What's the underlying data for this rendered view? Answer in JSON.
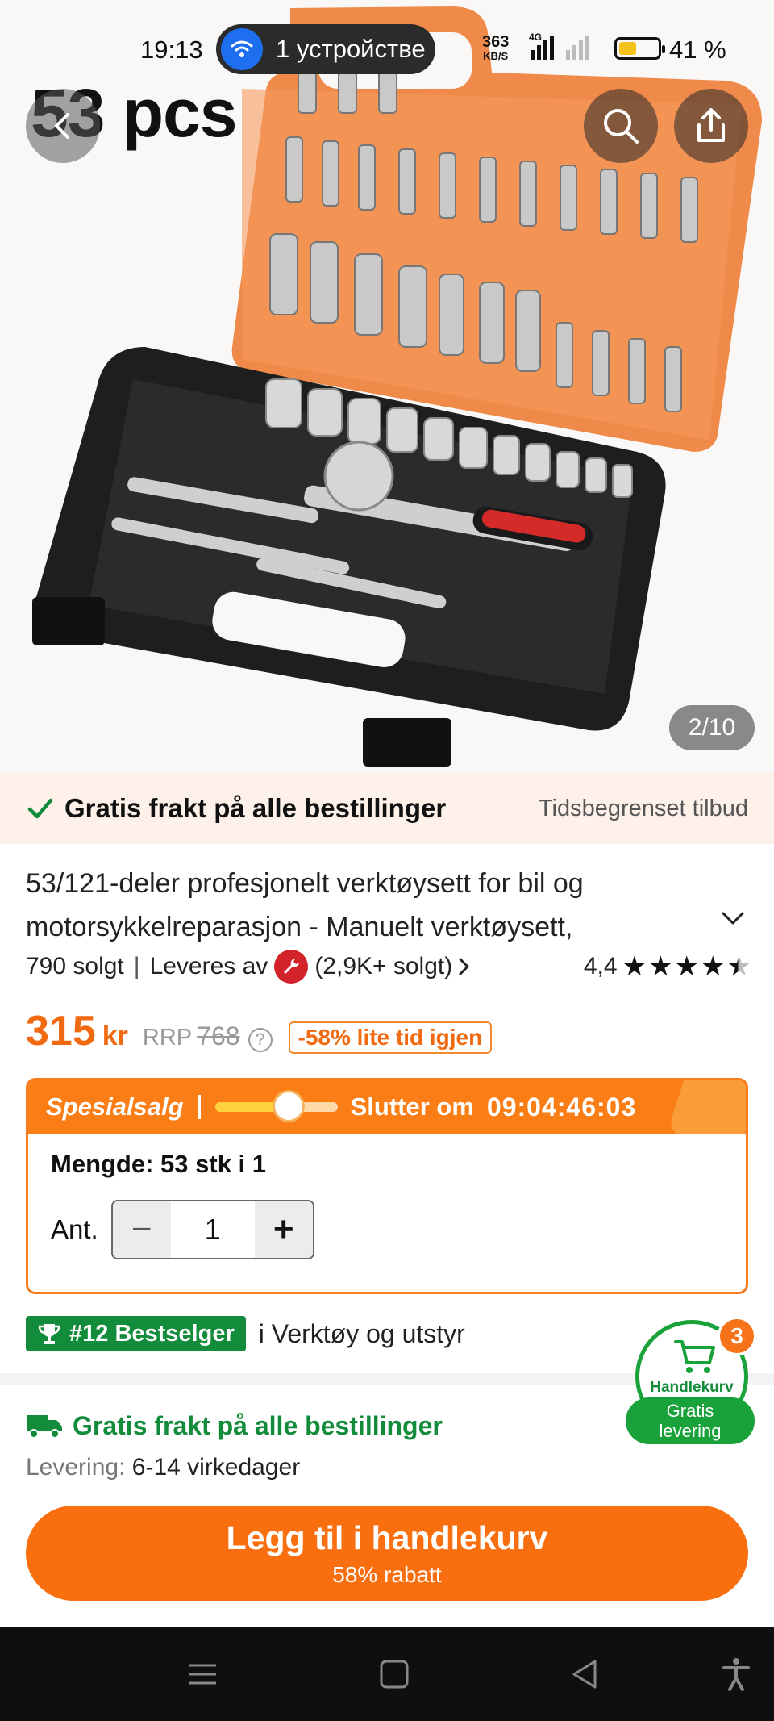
{
  "status_bar": {
    "time": "19:13",
    "connection_pill": "1 устройстве",
    "speed_value": "363",
    "speed_unit": "KB/S",
    "network": "4G",
    "battery_percent": "41 %",
    "battery_level": 0.41
  },
  "hero": {
    "overlay_text": "53 pcs",
    "image_counter": "2/10"
  },
  "shipping_banner": {
    "message": "Gratis frakt på alle bestillinger",
    "offer": "Tidsbegrenset tilbud"
  },
  "product": {
    "title_line1": "53/121-deler profesjonelt verktøysett for bil og",
    "title_line2": "motorsykkelreparasjon - Manuelt verktøysett,",
    "sold": "790 solgt",
    "sold_by": "Leveres av",
    "shop_sold": "(2,9K+ solgt)",
    "rating_value": "4,4",
    "rating": 4.4
  },
  "price": {
    "value": "315",
    "currency": "kr",
    "rrp_label": "RRP",
    "rrp_value": "768",
    "help": "?",
    "discount_badge": "-58% lite tid igjen"
  },
  "sale": {
    "label": "Spesialsalg",
    "progress": 0.6,
    "ends_label": "Slutter om",
    "timer": "09:04:46:03",
    "quantity_title": "Mengde: 53 stk i 1",
    "amount_label": "Ant.",
    "amount_value": "1",
    "minus": "−",
    "plus": "+"
  },
  "bestseller": {
    "badge": "#12 Bestselger",
    "category": "i Verktøy og utstyr"
  },
  "delivery": {
    "free_shipping": "Gratis frakt på alle bestillinger",
    "label": "Levering:",
    "time": "6-14 virkedager"
  },
  "cart_float": {
    "label": "Handlekurv",
    "count": "3",
    "badge_line1": "Gratis",
    "badge_line2": "levering"
  },
  "add_to_cart": {
    "label": "Legg til i handlekurv",
    "sub": "58% rabatt"
  },
  "colors": {
    "accent": "#f96f0f",
    "green": "#128c3a",
    "price": "#f16a11"
  },
  "icons": [
    "back-arrow-icon",
    "search-icon",
    "share-icon",
    "check-icon",
    "chevron-down-icon",
    "chevron-right-icon",
    "wrench-icon",
    "star-icon",
    "help-icon",
    "clock-icon",
    "trophy-icon",
    "truck-icon",
    "cart-icon",
    "menu-icon",
    "home-icon",
    "back-icon",
    "accessibility-icon"
  ]
}
